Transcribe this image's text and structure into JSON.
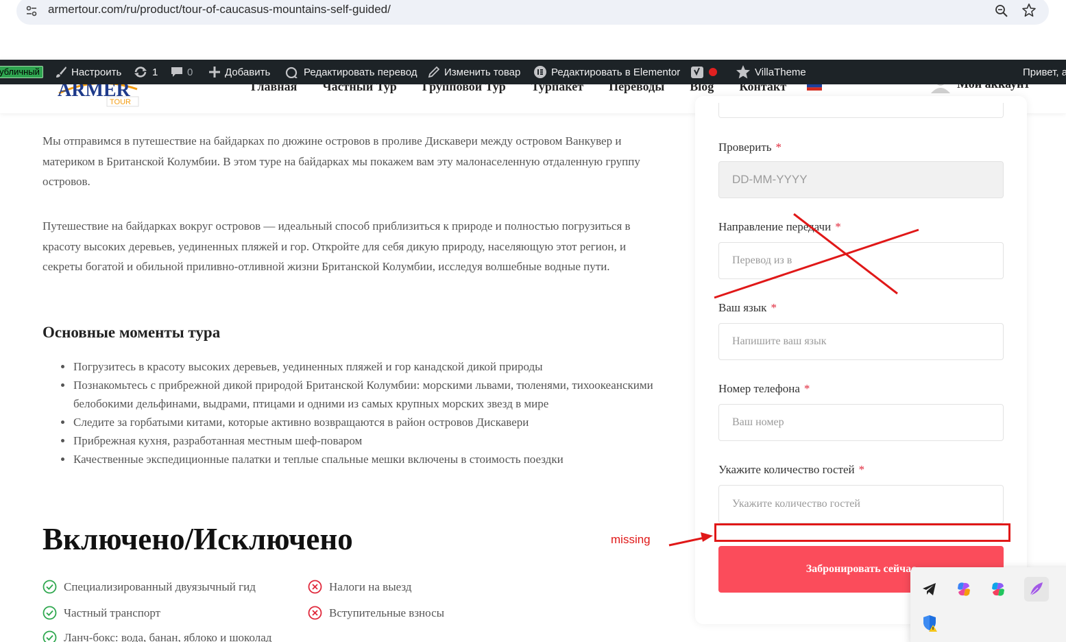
{
  "browser": {
    "url": "armertour.com/ru/product/tour-of-caucasus-mountains-self-guided/"
  },
  "adminbar": {
    "public_badge": "убличный",
    "customize": "Настроить",
    "updates_count": "1",
    "comments_count": "0",
    "add_new": "Добавить",
    "edit_translation": "Редактировать перевод",
    "edit_product": "Изменить товар",
    "edit_elementor": "Редактировать в Elementor",
    "villatheme": "VillaTheme",
    "greeting": "Привет, а"
  },
  "site_header": {
    "logo_text": "ARMER",
    "logo_sub": "TOUR",
    "nav": [
      "Главная",
      "Частный Тур",
      "Групповой Тур",
      "Турпакет",
      "Переводы",
      "Blog",
      "Контакт"
    ],
    "account": "Мой аккаунт"
  },
  "content": {
    "para1": "Мы отправимся в путешествие на байдарках по дюжине островов в проливе Дискавери между островом Ванкувер и материком в Британской Колумбии. В этом туре на байдарках мы покажем вам эту малонаселенную отдаленную группу островов.",
    "para2": "Путешествие на байдарках вокруг островов — идеальный способ приблизиться к природе и полностью погрузиться в красоту высоких деревьев, уединенных пляжей и гор. Откройте для себя дикую природу, населяющую этот регион, и секреты богатой и обильной приливно-отливной жизни Британской Колумбии, исследуя волшебные водные пути.",
    "highlights_title": "Основные моменты тура",
    "highlights": [
      "Погрузитесь в красоту высоких деревьев, уединенных пляжей и гор канадской дикой природы",
      "Познакомьтесь с прибрежной дикой природой Британской Колумбии: морскими львами, тюленями, тихоокеанскими белобокими дельфинами, выдрами, птицами и одними из самых крупных морских звезд в мире",
      "Следите за горбатыми китами, которые активно возвращаются в район островов Дискавери",
      "Прибрежная кухня, разработанная местным шеф-поваром",
      "Качественные экспедиционные палатки и теплые спальные мешки включены в стоимость поездки"
    ],
    "included_title": "Включено/Исключено",
    "included": [
      "Специализированный двуязычный гид",
      "Частный транспорт",
      "Ланч-бокс: вода, банан, яблоко и шоколад"
    ],
    "excluded": [
      "Налоги на выезд",
      "Вступительные взносы"
    ]
  },
  "form": {
    "check_label": "Проверить",
    "check_placeholder": "DD-MM-YYYY",
    "direction_label": "Направление передачи",
    "direction_placeholder": "Перевод из в",
    "language_label": "Ваш язык",
    "language_placeholder": "Напишите ваш язык",
    "phone_label": "Номер телефона",
    "phone_placeholder": "Ваш номер",
    "guests_label": "Укажите количество гостей",
    "guests_placeholder": "Укажите количество гостей",
    "required_mark": "*",
    "book_button": "Забронировать сейчас"
  },
  "annotation": {
    "missing_label": "missing",
    "color": "#e01818"
  },
  "colors": {
    "accent": "#fb4c5b",
    "adminbar": "#1d2327",
    "check_green": "#2fa84f",
    "x_red": "#e0283b"
  }
}
